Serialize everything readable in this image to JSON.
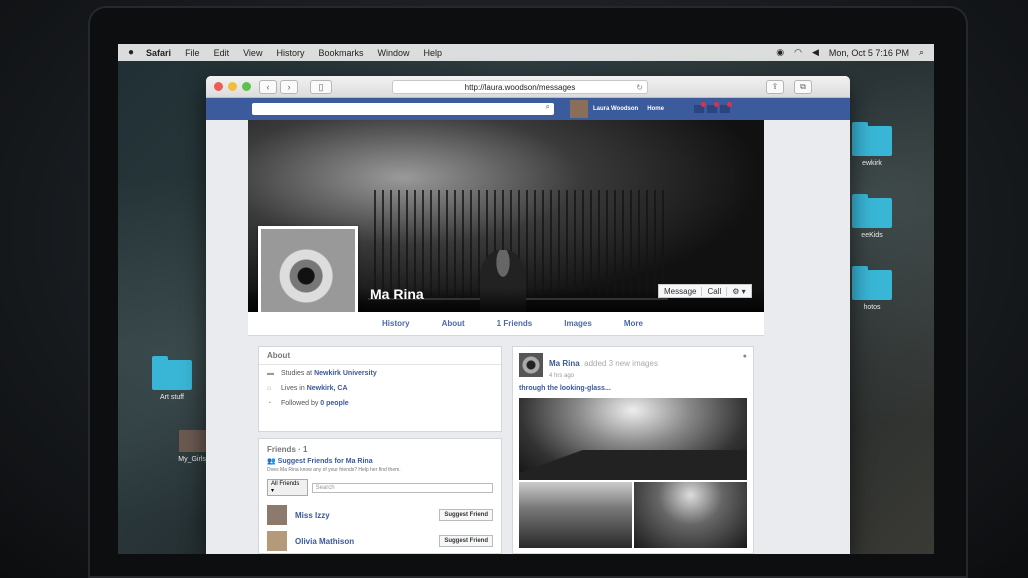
{
  "menubar": {
    "apple": "",
    "app": "Safari",
    "items": [
      "File",
      "Edit",
      "View",
      "History",
      "Bookmarks",
      "Window",
      "Help"
    ],
    "clock": "Mon, Oct 5  7:16 PM"
  },
  "desktop": {
    "folders": [
      {
        "label": "Art stuff"
      },
      {
        "label": "My_Girls_"
      },
      {
        "label": "ewkirk"
      },
      {
        "label": "eeKids"
      },
      {
        "label": "hotos"
      }
    ]
  },
  "browser": {
    "url": "http://laura.woodson/messages"
  },
  "fbbar": {
    "user_name": "Laura Woodson",
    "home": "Home"
  },
  "profile": {
    "name": "Ma Rina",
    "cover_buttons": {
      "message": "Message",
      "call": "Call",
      "settings": "⚙ ▾"
    },
    "tabs": [
      "History",
      "About",
      "1 Friends",
      "Images",
      "More"
    ]
  },
  "about": {
    "header": "About",
    "rows": [
      {
        "prefix": "Studies at ",
        "link": "Newkirk University"
      },
      {
        "prefix": "Lives in ",
        "link": "Newkirk, CA"
      },
      {
        "prefix": "Followed by ",
        "link": "0 people"
      }
    ]
  },
  "friends": {
    "header": "Friends · 1",
    "suggest_prefix": "Suggest Friends for",
    "suggest_name": "Ma Rina",
    "suggest_sub": "Does Ma Rina know any of your friends? Help her find them.",
    "filter": "All Friends ▾",
    "search_placeholder": "Search",
    "list": [
      {
        "name": "Miss Izzy",
        "action": "Suggest Friend"
      },
      {
        "name": "Olivia Mathison",
        "action": "Suggest Friend"
      }
    ]
  },
  "post": {
    "author": "Ma Rina",
    "action": "added 3 new images",
    "time": "4 hrs ago",
    "caption": "through the looking-glass..."
  }
}
